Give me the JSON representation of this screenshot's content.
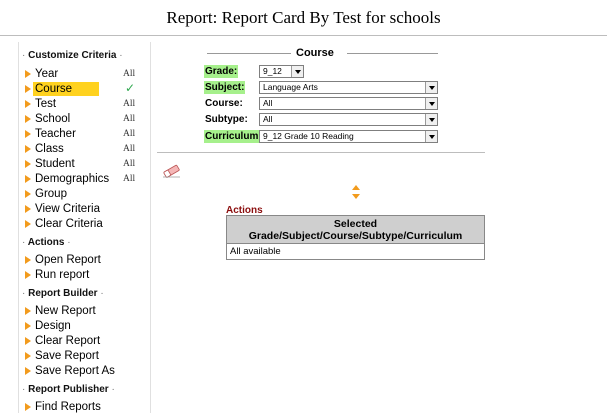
{
  "page_title": "Report: Report Card By Test for schools",
  "sidebar": {
    "sections": [
      {
        "title": "Customize Criteria",
        "items": [
          {
            "label": "Year",
            "value": "All"
          },
          {
            "label": "Course",
            "value": "✓",
            "selected": true
          },
          {
            "label": "Test",
            "value": "All"
          },
          {
            "label": "School",
            "value": "All"
          },
          {
            "label": "Teacher",
            "value": "All"
          },
          {
            "label": "Class",
            "value": "All"
          },
          {
            "label": "Student",
            "value": "All"
          },
          {
            "label": "Demographics",
            "value": "All"
          },
          {
            "label": "Group",
            "value": ""
          },
          {
            "label": "View Criteria",
            "value": ""
          },
          {
            "label": "Clear Criteria",
            "value": ""
          }
        ]
      },
      {
        "title": "Actions",
        "items": [
          {
            "label": "Open Report",
            "value": ""
          },
          {
            "label": "Run report",
            "value": ""
          }
        ]
      },
      {
        "title": "Report Builder",
        "items": [
          {
            "label": "New Report",
            "value": ""
          },
          {
            "label": "Design",
            "value": ""
          },
          {
            "label": "Clear Report",
            "value": ""
          },
          {
            "label": "Save Report",
            "value": ""
          },
          {
            "label": "Save Report As",
            "value": ""
          }
        ]
      },
      {
        "title": "Report Publisher",
        "items": [
          {
            "label": "Find Reports",
            "value": ""
          }
        ]
      }
    ]
  },
  "course_panel": {
    "legend": "Course",
    "grade": {
      "label": "Grade:",
      "value": "9_12"
    },
    "subject": {
      "label": "Subject:",
      "value": "Language Arts"
    },
    "course": {
      "label": "Course:",
      "value": "All"
    },
    "subtype": {
      "label": "Subtype:",
      "value": "All"
    },
    "curriculum": {
      "label": "Curriculum:",
      "value": "9_12 Grade 10 Reading"
    }
  },
  "actions": {
    "title": "Actions",
    "table_header_line1": "Selected",
    "table_header_line2": "Grade/Subject/Course/Subtype/Curriculum",
    "row": "All available"
  },
  "colors": {
    "arrow": "#f29b1d",
    "selected_highlight": "#ffd21f",
    "label_green": "#a6f08c",
    "check_green": "#2fa84f",
    "actions_title": "#8b0e0e"
  }
}
